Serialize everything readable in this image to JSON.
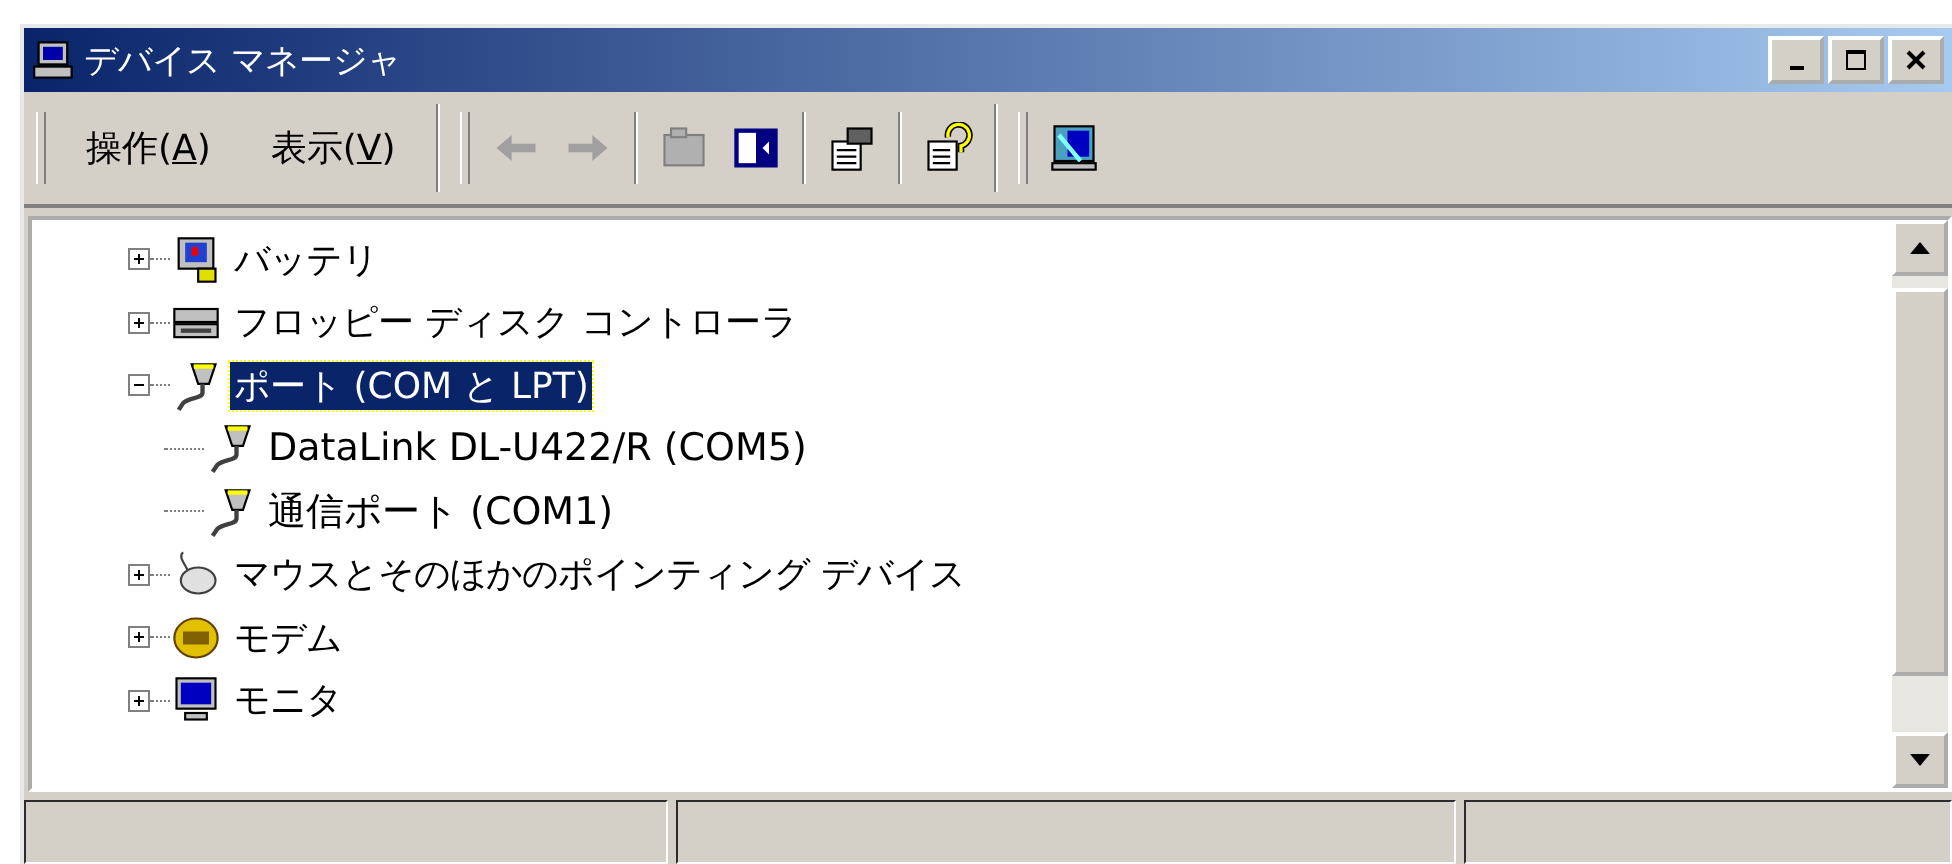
{
  "window": {
    "title": "デバイス マネージャ"
  },
  "menu": [
    {
      "label": "操作(A)"
    },
    {
      "label": "表示(V)"
    }
  ],
  "tree": [
    {
      "label": "バッテリ",
      "kind": "battery",
      "expanded": false,
      "selected": false
    },
    {
      "label": "フロッピー ディスク コントローラ",
      "kind": "floppy",
      "expanded": false,
      "selected": false
    },
    {
      "label": "ポート (COM と LPT)",
      "kind": "port",
      "expanded": true,
      "selected": true,
      "children": [
        {
          "label": "DataLink DL-U422/R (COM5)",
          "kind": "port",
          "selected": false
        },
        {
          "label": "通信ポート (COM1)",
          "kind": "port",
          "selected": false
        }
      ]
    },
    {
      "label": "マウスとそのほかのポインティング デバイス",
      "kind": "mouse",
      "expanded": false,
      "selected": false
    },
    {
      "label": "モデム",
      "kind": "modem",
      "expanded": false,
      "selected": false
    },
    {
      "label": "モニタ",
      "kind": "monitor",
      "expanded": false,
      "selected": false
    }
  ]
}
